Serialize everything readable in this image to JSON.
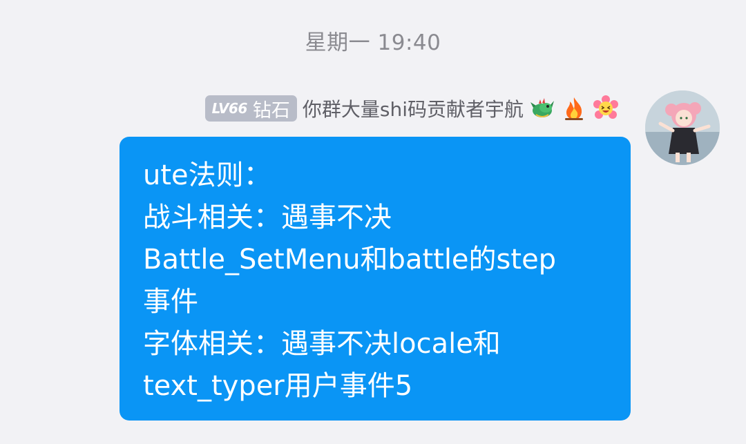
{
  "timestamp": "星期一 19:40",
  "sender": {
    "level": "LV66",
    "rank": "钻石",
    "name": "你群大量shi码贡献者宇航",
    "emojis": [
      "dragon-emoji",
      "fire-emoji",
      "laughing-flower-emoji"
    ]
  },
  "message": {
    "lines": [
      "ute法则：",
      "战斗相关：遇事不决",
      "Battle_SetMenu和battle的step",
      "事件",
      "字体相关：遇事不决locale和",
      "text_typer用户事件5"
    ]
  },
  "colors": {
    "bubble": "#0a95f5",
    "badge": "#b8bcc8",
    "background": "#f2f2f5"
  }
}
